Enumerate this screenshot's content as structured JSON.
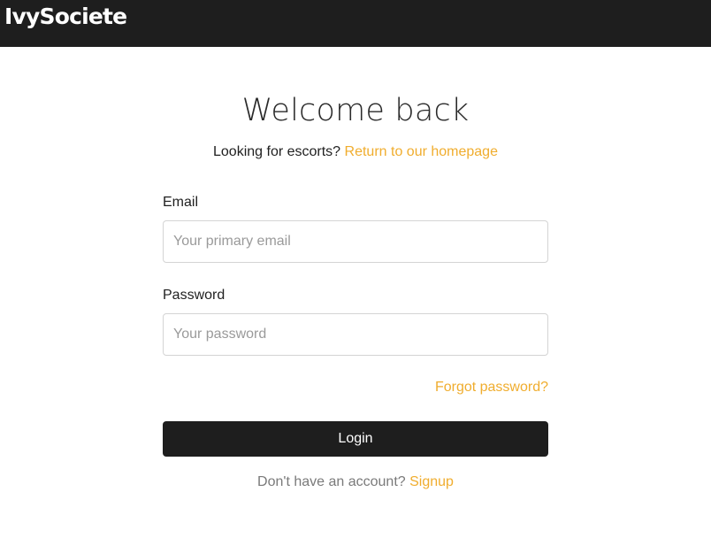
{
  "header": {
    "logo_text": "IvySociete"
  },
  "main": {
    "title": "Welcome back",
    "subtitle_text": "Looking for escorts?",
    "homepage_link": "Return to our homepage",
    "email": {
      "label": "Email",
      "placeholder": "Your primary email",
      "value": ""
    },
    "password": {
      "label": "Password",
      "placeholder": "Your password",
      "value": ""
    },
    "forgot_link": "Forgot password?",
    "login_label": "Login",
    "signup_prompt": "Don't have an account?",
    "signup_link": "Signup"
  },
  "colors": {
    "topbar": "#1e1e1e",
    "accent": "#f0ad2e",
    "button": "#1e1e1e"
  }
}
